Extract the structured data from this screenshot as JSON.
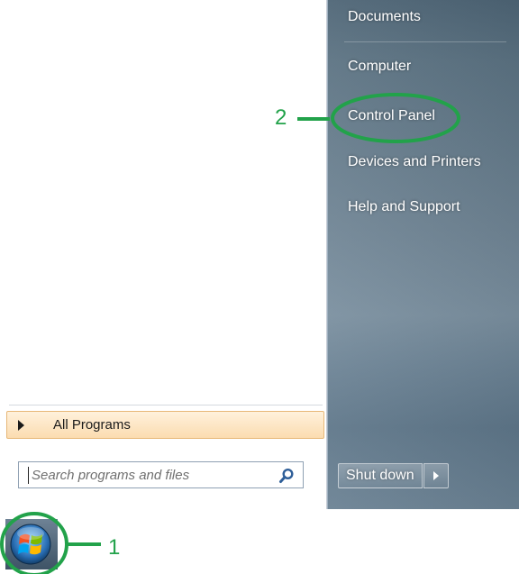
{
  "left_pane": {
    "all_programs_label": "All Programs",
    "search": {
      "placeholder": "Search programs and files",
      "value": ""
    }
  },
  "right_pane": {
    "items": [
      {
        "label": "Documents"
      },
      {
        "label": "Computer"
      },
      {
        "label": "Control Panel"
      },
      {
        "label": "Devices and Printers"
      },
      {
        "label": "Help and Support"
      }
    ],
    "shutdown_label": "Shut down"
  },
  "annotations": {
    "control_panel_marker": "2",
    "start_button_marker": "1",
    "highlight_color": "#22a24a"
  },
  "icons": {
    "search": "search-icon",
    "start": "windows-logo-icon",
    "shutdown_options": "chevron-right-icon"
  }
}
